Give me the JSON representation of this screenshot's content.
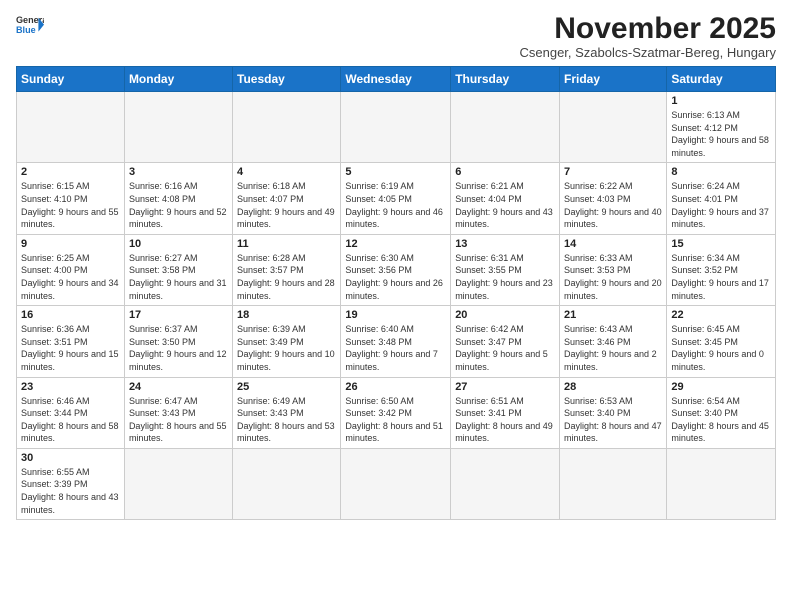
{
  "logo": {
    "text_general": "General",
    "text_blue": "Blue"
  },
  "header": {
    "month": "November 2025",
    "location": "Csenger, Szabolcs-Szatmar-Bereg, Hungary"
  },
  "weekdays": [
    "Sunday",
    "Monday",
    "Tuesday",
    "Wednesday",
    "Thursday",
    "Friday",
    "Saturday"
  ],
  "weeks": [
    [
      {
        "day": "",
        "info": ""
      },
      {
        "day": "",
        "info": ""
      },
      {
        "day": "",
        "info": ""
      },
      {
        "day": "",
        "info": ""
      },
      {
        "day": "",
        "info": ""
      },
      {
        "day": "",
        "info": ""
      },
      {
        "day": "1",
        "info": "Sunrise: 6:13 AM\nSunset: 4:12 PM\nDaylight: 9 hours and 58 minutes."
      }
    ],
    [
      {
        "day": "2",
        "info": "Sunrise: 6:15 AM\nSunset: 4:10 PM\nDaylight: 9 hours and 55 minutes."
      },
      {
        "day": "3",
        "info": "Sunrise: 6:16 AM\nSunset: 4:08 PM\nDaylight: 9 hours and 52 minutes."
      },
      {
        "day": "4",
        "info": "Sunrise: 6:18 AM\nSunset: 4:07 PM\nDaylight: 9 hours and 49 minutes."
      },
      {
        "day": "5",
        "info": "Sunrise: 6:19 AM\nSunset: 4:05 PM\nDaylight: 9 hours and 46 minutes."
      },
      {
        "day": "6",
        "info": "Sunrise: 6:21 AM\nSunset: 4:04 PM\nDaylight: 9 hours and 43 minutes."
      },
      {
        "day": "7",
        "info": "Sunrise: 6:22 AM\nSunset: 4:03 PM\nDaylight: 9 hours and 40 minutes."
      },
      {
        "day": "8",
        "info": "Sunrise: 6:24 AM\nSunset: 4:01 PM\nDaylight: 9 hours and 37 minutes."
      }
    ],
    [
      {
        "day": "9",
        "info": "Sunrise: 6:25 AM\nSunset: 4:00 PM\nDaylight: 9 hours and 34 minutes."
      },
      {
        "day": "10",
        "info": "Sunrise: 6:27 AM\nSunset: 3:58 PM\nDaylight: 9 hours and 31 minutes."
      },
      {
        "day": "11",
        "info": "Sunrise: 6:28 AM\nSunset: 3:57 PM\nDaylight: 9 hours and 28 minutes."
      },
      {
        "day": "12",
        "info": "Sunrise: 6:30 AM\nSunset: 3:56 PM\nDaylight: 9 hours and 26 minutes."
      },
      {
        "day": "13",
        "info": "Sunrise: 6:31 AM\nSunset: 3:55 PM\nDaylight: 9 hours and 23 minutes."
      },
      {
        "day": "14",
        "info": "Sunrise: 6:33 AM\nSunset: 3:53 PM\nDaylight: 9 hours and 20 minutes."
      },
      {
        "day": "15",
        "info": "Sunrise: 6:34 AM\nSunset: 3:52 PM\nDaylight: 9 hours and 17 minutes."
      }
    ],
    [
      {
        "day": "16",
        "info": "Sunrise: 6:36 AM\nSunset: 3:51 PM\nDaylight: 9 hours and 15 minutes."
      },
      {
        "day": "17",
        "info": "Sunrise: 6:37 AM\nSunset: 3:50 PM\nDaylight: 9 hours and 12 minutes."
      },
      {
        "day": "18",
        "info": "Sunrise: 6:39 AM\nSunset: 3:49 PM\nDaylight: 9 hours and 10 minutes."
      },
      {
        "day": "19",
        "info": "Sunrise: 6:40 AM\nSunset: 3:48 PM\nDaylight: 9 hours and 7 minutes."
      },
      {
        "day": "20",
        "info": "Sunrise: 6:42 AM\nSunset: 3:47 PM\nDaylight: 9 hours and 5 minutes."
      },
      {
        "day": "21",
        "info": "Sunrise: 6:43 AM\nSunset: 3:46 PM\nDaylight: 9 hours and 2 minutes."
      },
      {
        "day": "22",
        "info": "Sunrise: 6:45 AM\nSunset: 3:45 PM\nDaylight: 9 hours and 0 minutes."
      }
    ],
    [
      {
        "day": "23",
        "info": "Sunrise: 6:46 AM\nSunset: 3:44 PM\nDaylight: 8 hours and 58 minutes."
      },
      {
        "day": "24",
        "info": "Sunrise: 6:47 AM\nSunset: 3:43 PM\nDaylight: 8 hours and 55 minutes."
      },
      {
        "day": "25",
        "info": "Sunrise: 6:49 AM\nSunset: 3:43 PM\nDaylight: 8 hours and 53 minutes."
      },
      {
        "day": "26",
        "info": "Sunrise: 6:50 AM\nSunset: 3:42 PM\nDaylight: 8 hours and 51 minutes."
      },
      {
        "day": "27",
        "info": "Sunrise: 6:51 AM\nSunset: 3:41 PM\nDaylight: 8 hours and 49 minutes."
      },
      {
        "day": "28",
        "info": "Sunrise: 6:53 AM\nSunset: 3:40 PM\nDaylight: 8 hours and 47 minutes."
      },
      {
        "day": "29",
        "info": "Sunrise: 6:54 AM\nSunset: 3:40 PM\nDaylight: 8 hours and 45 minutes."
      }
    ],
    [
      {
        "day": "30",
        "info": "Sunrise: 6:55 AM\nSunset: 3:39 PM\nDaylight: 8 hours and 43 minutes."
      },
      {
        "day": "",
        "info": ""
      },
      {
        "day": "",
        "info": ""
      },
      {
        "day": "",
        "info": ""
      },
      {
        "day": "",
        "info": ""
      },
      {
        "day": "",
        "info": ""
      },
      {
        "day": "",
        "info": ""
      }
    ]
  ]
}
